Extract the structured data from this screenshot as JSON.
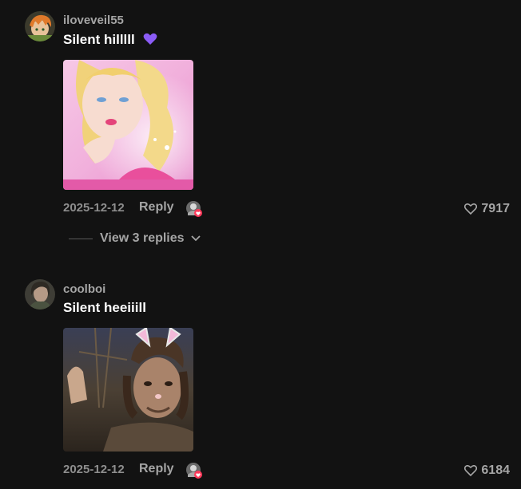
{
  "comments": [
    {
      "username": "iloveveil55",
      "text": "Silent hilllll",
      "emoji": "💜",
      "date": "2025-12-12",
      "reply_label": "Reply",
      "likes": "7917"
    },
    {
      "username": "coolboi",
      "text": "Silent heeiiill",
      "date": "2025-12-12",
      "reply_label": "Reply",
      "likes": "6184"
    }
  ],
  "view_replies_label": "View 3 replies",
  "colors": {
    "background": "#121212",
    "username": "#a5a5a5",
    "text": "#ffffff",
    "meta": "#8e8e8e",
    "emoji_purple": "#8b5cf6"
  }
}
